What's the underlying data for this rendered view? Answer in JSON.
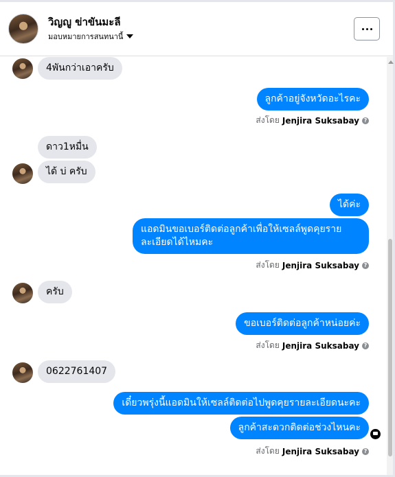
{
  "header": {
    "name": "วิญญู ข่าขันมะลี",
    "subtitle": "มอบหมายการสนทนานี้",
    "more_button": "more-options"
  },
  "sender": "Jenjira Suksabay",
  "sent_by_prefix": "ส่งโดย",
  "messages": [
    {
      "dir": "in",
      "text": "4พันกว่าเอาครับ"
    },
    {
      "dir": "out",
      "text": "ลูกค้าอยู่จังหวัดอะไรคะ"
    },
    {
      "dir": "in",
      "text": "ดาว1หมื่น"
    },
    {
      "dir": "in",
      "text": "ได้  บ่  ครับ"
    },
    {
      "dir": "out",
      "text": "ได้ค่ะ"
    },
    {
      "dir": "out",
      "text": "แอดมินขอเบอร์ติดต่อลูกค้าเพื่อให้เซลล์พูดคุยรายละเอียดได้ไหมคะ"
    },
    {
      "dir": "in",
      "text": "ครับ"
    },
    {
      "dir": "out",
      "text": "ขอเบอร์ติดต่อลูกค้าหน่อยค่ะ"
    },
    {
      "dir": "in",
      "text": "0622761407"
    },
    {
      "dir": "out",
      "text": "เดี๋ยวพรุ่งนี้แอดมินให้เซลล์ติดต่อไปพูดคุยรายละเอียดนะคะ"
    },
    {
      "dir": "out",
      "text": "ลูกค้าสะดวกติดต่อช่วงไหนคะ"
    }
  ],
  "colors": {
    "outgoing": "#0084ff",
    "incoming": "#e4e6eb"
  }
}
